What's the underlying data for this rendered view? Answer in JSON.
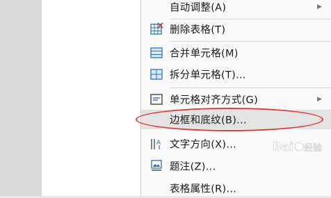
{
  "menu": {
    "items": [
      {
        "label": "自动调整(A)",
        "icon": "none",
        "submenu": true
      },
      {
        "label": "删除表格(T)",
        "icon": "delete-table-icon",
        "submenu": false
      },
      {
        "label": "合并单元格(M)",
        "icon": "merge-cells-icon",
        "submenu": false
      },
      {
        "label": "拆分单元格(T)...",
        "icon": "split-cells-icon",
        "submenu": false
      },
      {
        "label": "单元格对齐方式(G)",
        "icon": "cell-alignment-icon",
        "submenu": true
      },
      {
        "label": "边框和底纹(B)...",
        "icon": "none",
        "submenu": false,
        "highlighted": true
      },
      {
        "label": "文字方向(X)...",
        "icon": "text-direction-icon",
        "submenu": false
      },
      {
        "label": "题注(Z)...",
        "icon": "caption-icon",
        "submenu": false
      },
      {
        "label": "表格属性(R)...",
        "icon": "none",
        "submenu": false
      }
    ]
  },
  "annotation": {
    "color": "#e03a35"
  },
  "colors": {
    "highlight": "#e3e3e3",
    "menu_bg": "#f9f9f9",
    "icon_blue": "#2f6fb8",
    "icon_red": "#d9362b"
  }
}
